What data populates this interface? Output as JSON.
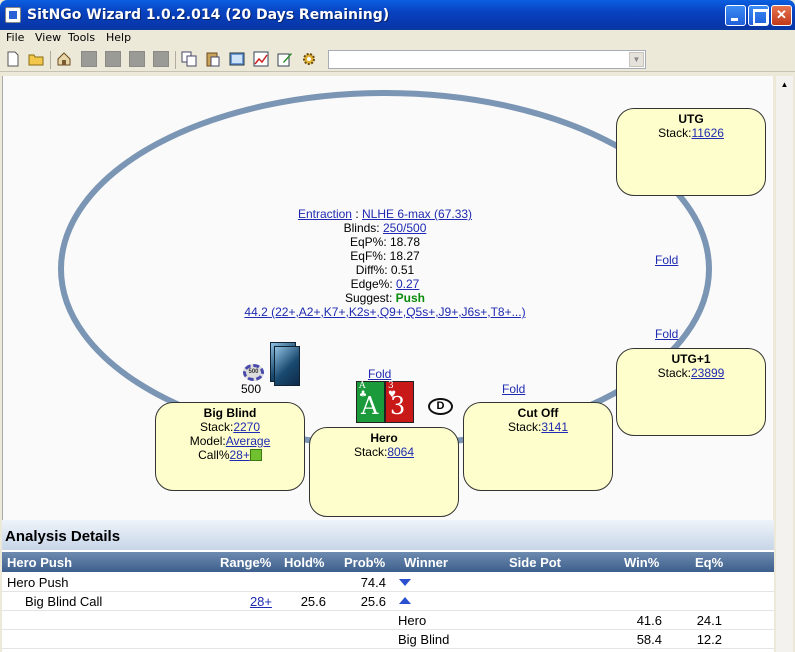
{
  "window": {
    "title": "SitNGo Wizard 1.0.2.014 (20 Days Remaining)"
  },
  "menu": [
    "File",
    "View",
    "Tools",
    "Help"
  ],
  "toolbar": {
    "icons": [
      "new-icon",
      "open-icon",
      "home-icon",
      "disabled-icon",
      "disabled-icon",
      "disabled-icon",
      "disabled-icon",
      "copy-icon",
      "paste-icon",
      "screenshot-icon",
      "chart-icon",
      "edit-icon",
      "settings-icon"
    ],
    "combo_value": ""
  },
  "table": {
    "site": "Entraction",
    "game": "NLHE 6-max (67.33)",
    "blinds": "250/500",
    "eqp": "18.78",
    "eqf": "18.27",
    "diff": "0.51",
    "edge": "0.27",
    "suggest": "Push",
    "range": "44.2 (22+,A2+,K7+,K2s+,Q9+,Q5s+,J9+,J6s+,T8+...)",
    "labels": {
      "sep": " : ",
      "blinds": "Blinds: ",
      "eqp": "EqP%: ",
      "eqf": "EqF%: ",
      "diff": "Diff%: ",
      "edge": "Edge%: ",
      "suggest": "Suggest: "
    }
  },
  "seats": {
    "utg": {
      "name": "UTG",
      "stack_label": "Stack:",
      "stack": "11626",
      "action": "Fold"
    },
    "utg1": {
      "name": "UTG+1",
      "stack_label": "Stack:",
      "stack": "23899",
      "action": "Fold"
    },
    "cutoff": {
      "name": "Cut Off",
      "stack_label": "Stack:",
      "stack": "3141",
      "action": "Fold"
    },
    "hero": {
      "name": "Hero",
      "stack_label": "Stack:",
      "stack": "8064",
      "action": "Fold",
      "cards": [
        "A",
        "3"
      ]
    },
    "bigblind": {
      "name": "Big Blind",
      "stack_label": "Stack:",
      "stack": "2270",
      "model_label": "Model:",
      "model": "Average",
      "call_label": "Call%",
      "call": "28+",
      "bet": "500",
      "chip": "500"
    },
    "dealer": "D"
  },
  "analysis": {
    "title": "Analysis Details",
    "columns": [
      "Hero Push",
      "Range%",
      "Hold%",
      "Prob%",
      "Winner",
      "Side Pot",
      "Win%",
      "Eq%"
    ],
    "rows": [
      {
        "label": "Hero Push",
        "range": "",
        "hold": "",
        "prob": "74.4",
        "winner": "",
        "win": "",
        "eq": ""
      },
      {
        "label": "Big Blind Call",
        "range": "28+",
        "hold": "25.6",
        "prob": "25.6",
        "winner": "",
        "win": "",
        "eq": ""
      },
      {
        "label": "",
        "range": "",
        "hold": "",
        "prob": "",
        "winner": "Hero",
        "win": "41.6",
        "eq": "24.1"
      },
      {
        "label": "",
        "range": "",
        "hold": "",
        "prob": "",
        "winner": "Big Blind",
        "win": "58.4",
        "eq": "12.2"
      }
    ]
  }
}
